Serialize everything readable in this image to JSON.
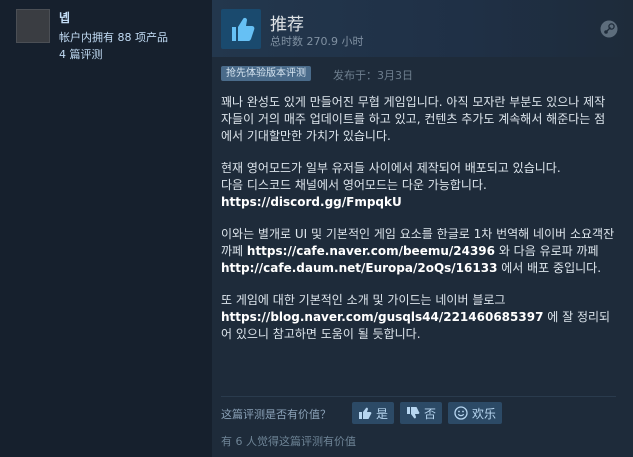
{
  "author": {
    "name": "녭",
    "products_owned": "帐户内拥有 88 项产品",
    "review_count": "4 篇评测"
  },
  "review": {
    "recommendation": "推荐",
    "hours": "总时数 270.9 小时",
    "early_access_badge": "抢先体验版本评测",
    "posted": "发布于：3月3日",
    "body": {
      "p1": "꽤나 완성도 있게 만들어진 무협 게임입니다. 아직 모자란 부분도 있으나 제작자들이 거의 매주 업데이트를 하고 있고, 컨텐츠 추가도 계속해서 해준다는 점에서 기대할만한 가치가 있습니다.",
      "p2_line1": "현재 영어모드가 일부 유저들 사이에서 제작되어 배포되고 있습니다.",
      "p2_line2": "다음 디스코드 채널에서 영어모드는 다운 가능합니다.",
      "p2_link": "https://discord.gg/FmpqkU",
      "p3_a": "이와는 별개로 UI 및 기본적인 게임 요소를 한글로 1차 번역해 네이버 소요객잔 까페 ",
      "p3_link1": "https://cafe.naver.com/beemu/24396",
      "p3_b": " 와 다음 유로파 까페 ",
      "p3_link2": "http://cafe.daum.net/Europa/2oQs/16133",
      "p3_c": " 에서 배포 중입니다.",
      "p4_a": "또 게임에 대한 기본적인 소개 및 가이드는 네이버 블로그 ",
      "p4_link": "https://blog.naver.com/gusqls44/221460685397",
      "p4_b": " 에 잘 정리되어 있으니 참고하면 도움이 될 듯합니다."
    }
  },
  "feedback": {
    "question": "这篇评测是否有价值？",
    "yes_label": "是",
    "no_label": "否",
    "funny_label": "欢乐",
    "helpful_count": "有 6 人觉得这篇评测有价值"
  },
  "colors": {
    "background": "#1b2838",
    "author_panel": "#16202d",
    "review_panel": "#1e2b3a",
    "accent_blue": "#66c0f4",
    "button": "#2c4a66"
  },
  "icons": [
    "thumbs-up-icon",
    "steam-logo-icon",
    "thumbs-down-icon",
    "smiley-icon"
  ]
}
